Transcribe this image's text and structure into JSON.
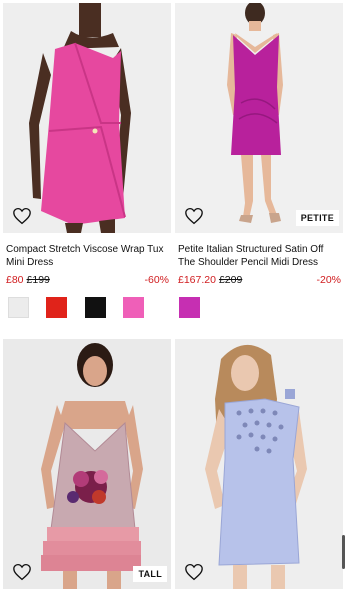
{
  "products": [
    {
      "title": "Compact Stretch Viscose Wrap Tux Mini Dress",
      "price_now": "£80",
      "price_was": "£199",
      "discount": "-60%",
      "badge": "",
      "swatch_colors": [
        "#ececec",
        "#e0231a",
        "#111111",
        "#ef5fb8"
      ]
    },
    {
      "title": "Petite Italian Structured Satin Off The Shoulder Pencil Midi Dress",
      "price_now": "£167.20",
      "price_was": "£209",
      "discount": "-20%",
      "badge": "PETITE",
      "swatch_colors": [
        "#c62fb2"
      ]
    },
    {
      "badge": "TALL"
    },
    {
      "badge": ""
    }
  ],
  "icons": {
    "favorite": "heart-outline-icon"
  }
}
